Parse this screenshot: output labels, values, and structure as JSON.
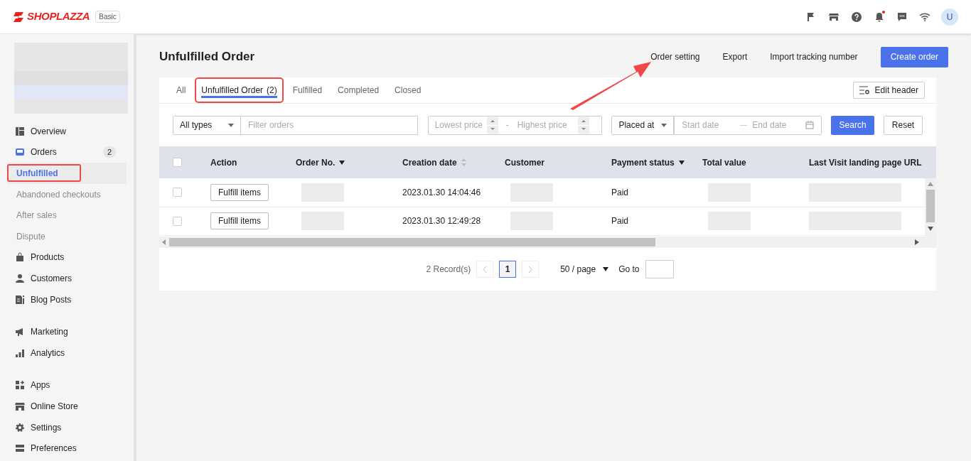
{
  "header": {
    "logo": "SHOPLAZZA",
    "plan": "Basic",
    "notifications_unread": true,
    "avatar": "U"
  },
  "sidebar": {
    "groups": [
      {
        "items": [
          {
            "label": "Overview",
            "selected": false
          },
          {
            "label": "Orders",
            "selected": false,
            "badge": "2",
            "children": [
              {
                "label": "Unfulfilled",
                "selected": true,
                "highlighted": true
              },
              {
                "label": "Abandoned checkouts",
                "selected": false,
                "highlighted": false
              },
              {
                "label": "After sales",
                "selected": false,
                "highlighted": false
              },
              {
                "label": "Dispute",
                "selected": false,
                "highlighted": false
              }
            ]
          },
          {
            "label": "Products",
            "selected": false
          },
          {
            "label": "Customers",
            "selected": false
          },
          {
            "label": "Blog Posts",
            "selected": false
          }
        ]
      },
      {
        "items": [
          {
            "label": "Marketing",
            "selected": false
          },
          {
            "label": "Analytics",
            "selected": false
          }
        ]
      },
      {
        "items": [
          {
            "label": "Apps",
            "selected": false
          },
          {
            "label": "Online Store",
            "selected": false
          },
          {
            "label": "Settings",
            "selected": false
          },
          {
            "label": "Preferences",
            "selected": false
          }
        ]
      }
    ]
  },
  "page": {
    "title": "Unfulfilled Order",
    "actions": [
      {
        "label": "Order setting",
        "kind": "link",
        "pointed_at": true
      },
      {
        "label": "Export",
        "kind": "link",
        "pointed_at": false
      },
      {
        "label": "Import tracking number",
        "kind": "link",
        "pointed_at": false
      },
      {
        "label": "Create order",
        "kind": "primary",
        "pointed_at": false
      }
    ]
  },
  "tabs": [
    {
      "label": "All",
      "selected": false,
      "highlighted": false
    },
    {
      "label": "Unfulfilled Order",
      "count": "(2)",
      "selected": true,
      "highlighted": true
    },
    {
      "label": "Fulfilled",
      "selected": false,
      "highlighted": false
    },
    {
      "label": "Completed",
      "selected": false,
      "highlighted": false
    },
    {
      "label": "Closed",
      "selected": false,
      "highlighted": false
    }
  ],
  "edit_header": "Edit header",
  "filters": {
    "type_select": "All types",
    "search_placeholder": "Filter orders",
    "price_min_placeholder": "Lowest price",
    "price_separator": "-",
    "price_max_placeholder": "Highest price",
    "date_select": "Placed at",
    "start_placeholder": "Start date",
    "end_placeholder": "End date",
    "search_button": "Search",
    "reset_button": "Reset"
  },
  "table": {
    "select_all_checked": false,
    "columns": [
      {
        "label": "Action",
        "kind": "plain"
      },
      {
        "label": "Order No.",
        "kind": "sorted"
      },
      {
        "label": "Creation date",
        "kind": "sortable"
      },
      {
        "label": "Customer",
        "kind": "plain"
      },
      {
        "label": "Payment status",
        "kind": "sorted"
      },
      {
        "label": "Total value",
        "kind": "plain"
      },
      {
        "label": "Last Visit landing page URL",
        "kind": "plain"
      }
    ],
    "rows": [
      {
        "checked": false,
        "action": "Fulfill items",
        "creation_date": "2023.01.30 14:04:46",
        "payment_status": "Paid"
      },
      {
        "checked": false,
        "action": "Fulfill items",
        "creation_date": "2023.01.30 12:49:28",
        "payment_status": "Paid"
      }
    ]
  },
  "pagination": {
    "records": "2 Record(s)",
    "pages": [
      {
        "label": "1",
        "selected": true
      }
    ],
    "page_size": "50 / page",
    "goto": "Go to"
  }
}
